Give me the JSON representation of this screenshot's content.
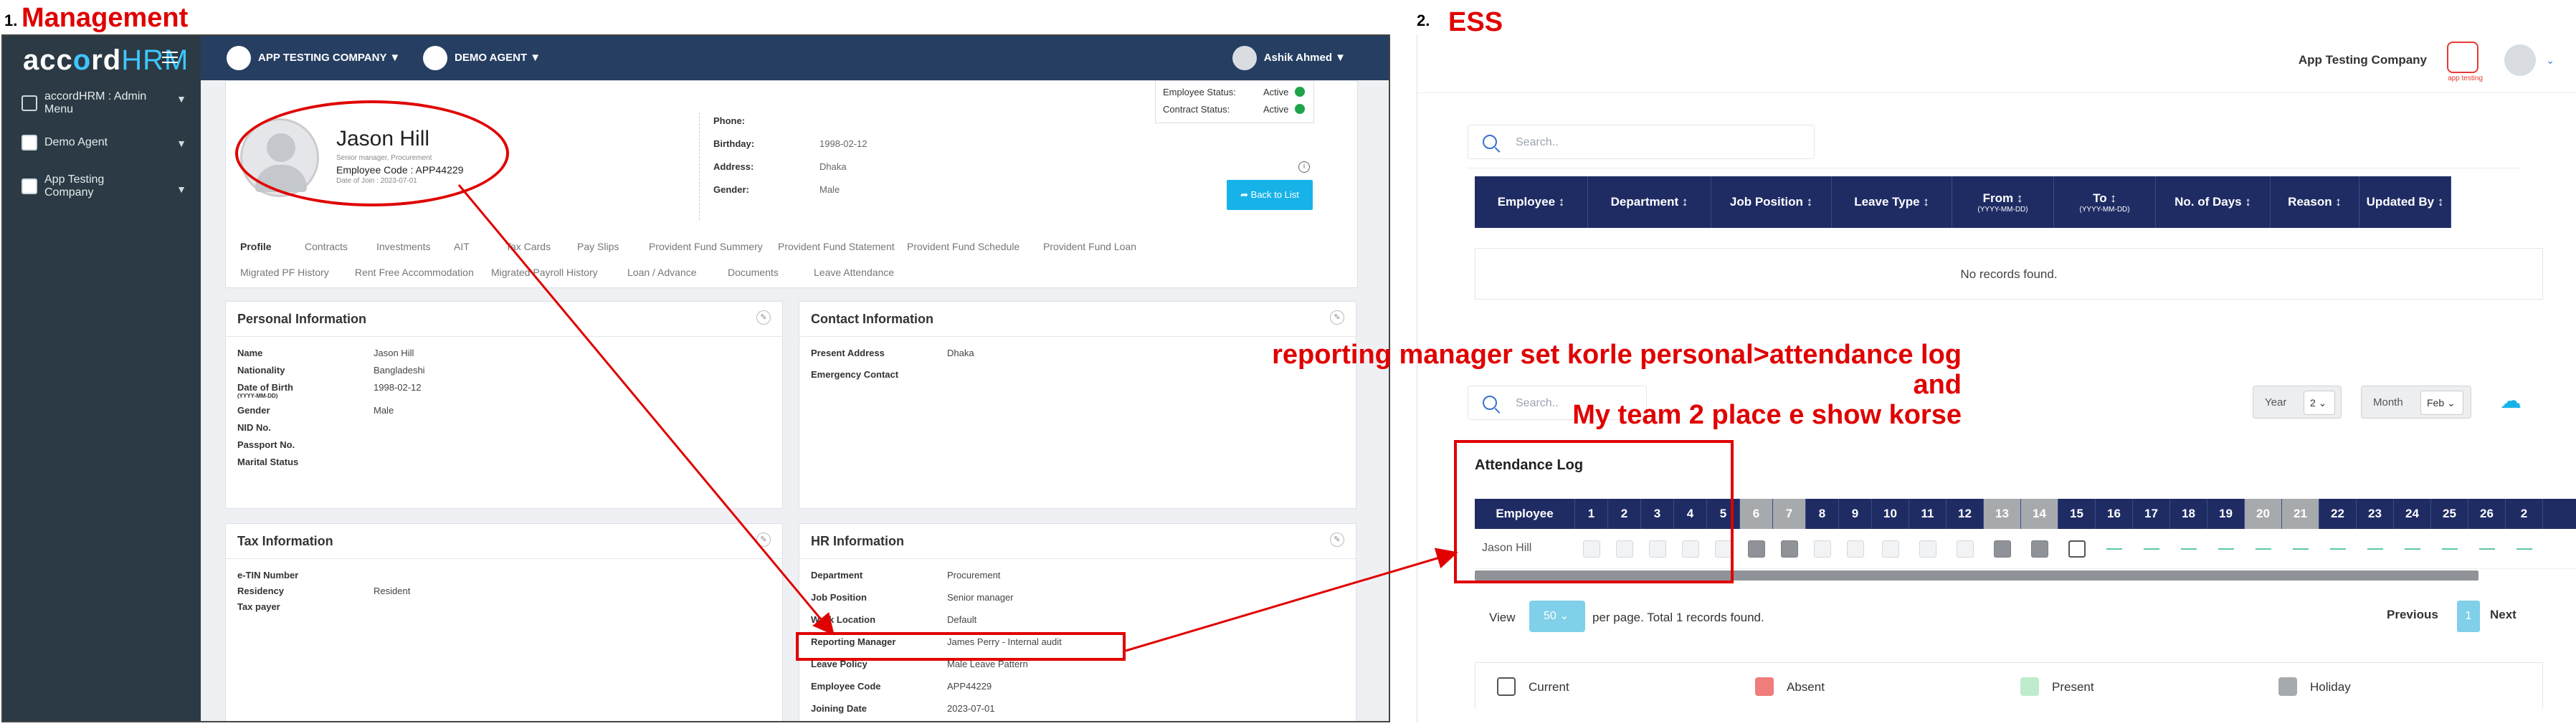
{
  "sections": {
    "left_num": "1.",
    "left_title": "Management",
    "right_num": "2.",
    "right_title": "ESS"
  },
  "colors": {
    "annotation": "#e00000",
    "topbar": "#253e62",
    "sidebar": "#2b3a44",
    "table_header": "#1f2c64",
    "active_check": "#1fa34a"
  },
  "mgmt": {
    "logo_main": "acc",
    "logo_o": "o",
    "logo_rd": "rd",
    "logo_hrm": "HRM",
    "sidebar": [
      {
        "label": "accordHRM : Admin Menu",
        "icon": "grid-icon"
      },
      {
        "label": "Demo Agent",
        "icon": "agent-icon"
      },
      {
        "label": "App Testing Company",
        "icon": "company-icon"
      }
    ],
    "topbar": {
      "company": "APP TESTING COMPANY",
      "agent": "DEMO AGENT",
      "user": "Ashik Ahmed"
    },
    "status": {
      "employee_status_label": "Employee Status:",
      "employee_status_value": "Active",
      "contract_status_label": "Contract Status:",
      "contract_status_value": "Active"
    },
    "profile": {
      "name": "Jason Hill",
      "designation": "Senior manager, Procurement",
      "employee_code": "Employee Code : APP44229",
      "date_of_join": "Date of Join : 2023-07-01",
      "phone_label": "Phone:",
      "phone_value": "",
      "birthday_label": "Birthday:",
      "birthday_value": "1998-02-12",
      "address_label": "Address:",
      "address_value": "Dhaka",
      "gender_label": "Gender:",
      "gender_value": "Male",
      "back_button": "Back to List"
    },
    "tabs_row1": [
      "Profile",
      "Contracts",
      "Investments",
      "AIT",
      "Tax Cards",
      "Pay Slips",
      "Provident Fund Summery",
      "Provident Fund Statement",
      "Provident Fund Schedule",
      "Provident Fund Loan"
    ],
    "tabs_row2": [
      "Migrated PF History",
      "Rent Free Accommodation",
      "Migrated Payroll History",
      "Loan / Advance",
      "Documents",
      "Leave Attendance"
    ],
    "personal": {
      "title": "Personal Information",
      "rows": [
        {
          "k": "Name",
          "v": "Jason Hill"
        },
        {
          "k": "Nationality",
          "v": "Bangladeshi"
        },
        {
          "k": "Date of Birth",
          "v": "1998-02-12"
        },
        {
          "k": "Gender",
          "v": "Male"
        },
        {
          "k": "NID No.",
          "v": ""
        },
        {
          "k": "Passport No.",
          "v": ""
        },
        {
          "k": "Marital Status",
          "v": ""
        }
      ],
      "dob_format": "(YYYY-MM-DD)"
    },
    "contact": {
      "title": "Contact Information",
      "rows": [
        {
          "k": "Present Address",
          "v": "Dhaka"
        },
        {
          "k": "Emergency Contact",
          "v": ""
        }
      ]
    },
    "tax": {
      "title": "Tax Information",
      "rows": [
        {
          "k": "e-TIN Number",
          "v": ""
        },
        {
          "k": "Residency",
          "v": "Resident"
        },
        {
          "k": "Tax payer",
          "v": ""
        }
      ]
    },
    "hr": {
      "title": "HR Information",
      "rows": [
        {
          "k": "Department",
          "v": "Procurement"
        },
        {
          "k": "Job Position",
          "v": "Senior manager"
        },
        {
          "k": "Work Location",
          "v": "Default"
        },
        {
          "k": "Reporting Manager",
          "v": "James Perry - Internal audit"
        },
        {
          "k": "Leave Policy",
          "v": "Male Leave Pattern"
        },
        {
          "k": "Employee Code",
          "v": "APP44229"
        },
        {
          "k": "Joining Date",
          "v": "2023-07-01"
        }
      ]
    }
  },
  "ess": {
    "company": "App Testing Company",
    "app_logo_text": "app testing",
    "search_placeholder": "Search..",
    "leave_columns": [
      {
        "label": "Employee",
        "sub": ""
      },
      {
        "label": "Department",
        "sub": ""
      },
      {
        "label": "Job Position",
        "sub": ""
      },
      {
        "label": "Leave Type",
        "sub": ""
      },
      {
        "label": "From",
        "sub": "(YYYY-MM-DD)"
      },
      {
        "label": "To",
        "sub": "(YYYY-MM-DD)"
      },
      {
        "label": "No. of Days",
        "sub": ""
      },
      {
        "label": "Reason",
        "sub": ""
      },
      {
        "label": "Updated By",
        "sub": ""
      }
    ],
    "no_records": "No records found.",
    "search2_placeholder": "Search..",
    "year_label": "Year",
    "year_value": "2",
    "month_label": "Month",
    "month_value": "Feb",
    "attendance_title": "Attendance Log",
    "attendance_employee_header": "Employee",
    "attendance_days": [
      "1",
      "2",
      "3",
      "4",
      "5",
      "6",
      "7",
      "8",
      "9",
      "10",
      "11",
      "12",
      "13",
      "14",
      "15",
      "16",
      "17",
      "18",
      "19",
      "20",
      "21",
      "22",
      "23",
      "24",
      "25",
      "26",
      "2"
    ],
    "attendance_gray_days": [
      6,
      7,
      13,
      14,
      20,
      21
    ],
    "attendance_row_name": "Jason Hill",
    "view_label": "View",
    "per_page_value": "50",
    "per_page_text": "per page. Total 1 records found.",
    "prev_label": "Previous",
    "page_number": "1",
    "next_label": "Next",
    "legend": [
      {
        "label": "Current",
        "color": "#ffffff"
      },
      {
        "label": "Absent",
        "color": "#f07c7c"
      },
      {
        "label": "Present",
        "color": "#bfeccc"
      },
      {
        "label": "Holiday",
        "color": "#a7aaad"
      }
    ]
  },
  "annotation": {
    "line1": "reporting manager set korle personal>attendance log",
    "line2": "and",
    "line3": "My team 2 place e show korse"
  }
}
